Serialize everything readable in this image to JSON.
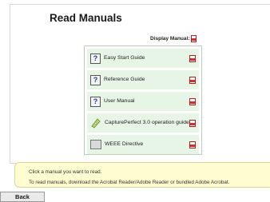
{
  "page": {
    "title": "Read Manuals",
    "display_manual_label": "Display Manual:"
  },
  "manuals": [
    {
      "label": "Easy Start Guide",
      "icon": "help-doc-icon"
    },
    {
      "label": "Reference Guide",
      "icon": "help-doc-icon"
    },
    {
      "label": "User Manual",
      "icon": "help-doc-icon"
    },
    {
      "label": "CapturePerfect 3.0 operation guide",
      "icon": "cd-icon"
    },
    {
      "label": "WEEE Directive",
      "icon": "book-icon"
    }
  ],
  "info": {
    "line1": "Click a manual you want to read.",
    "line2": "To read manuals, download the Acrobat Reader/Adobe Reader or bundled Adobe Acrobat."
  },
  "footer": {
    "back_label": "Back"
  },
  "colors": {
    "row_background": "#e6f5e6",
    "info_background": "#fffdd0",
    "pdf_red": "#d32f2f"
  }
}
